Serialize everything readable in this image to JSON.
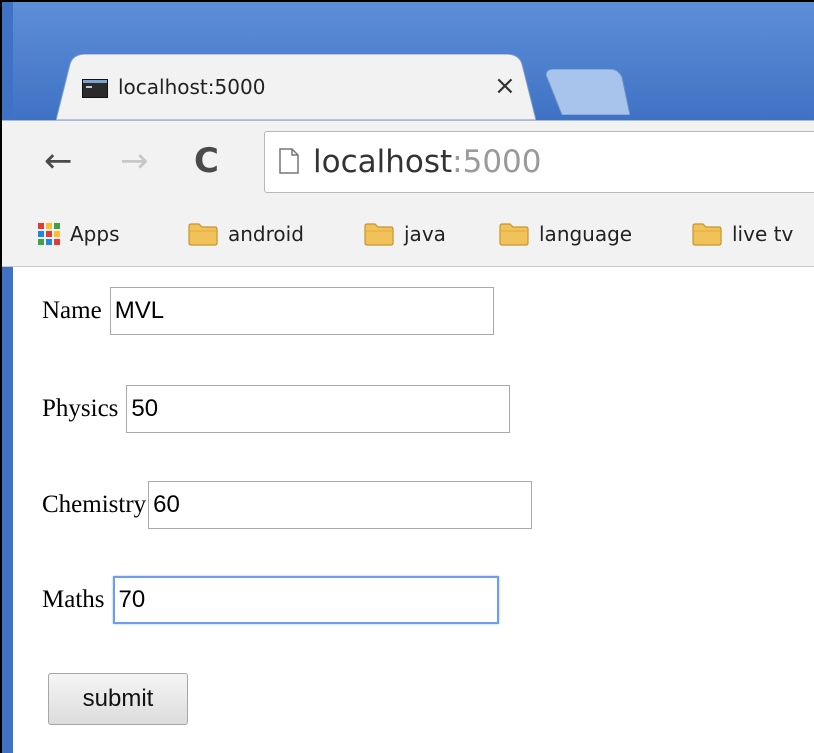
{
  "tab": {
    "title": "localhost:5000",
    "close_label": "×"
  },
  "toolbar": {
    "back_icon": "back-arrow-icon",
    "forward_icon": "forward-arrow-icon",
    "reload_icon": "reload-icon",
    "url_host": "localhost",
    "url_port": ":5000"
  },
  "bookmarks": {
    "items": [
      {
        "label": "Apps",
        "icon": "apps-grid-icon"
      },
      {
        "label": "android",
        "icon": "folder-icon"
      },
      {
        "label": "java",
        "icon": "folder-icon"
      },
      {
        "label": "language",
        "icon": "folder-icon"
      },
      {
        "label": "live tv",
        "icon": "folder-icon"
      }
    ]
  },
  "form": {
    "name": {
      "label": "Name",
      "value": "MVL"
    },
    "physics": {
      "label": "Physics",
      "value": "50"
    },
    "chemistry": {
      "label": "Chemistry",
      "value": "60"
    },
    "maths": {
      "label": "Maths",
      "value": "70"
    },
    "submit_label": "submit"
  },
  "colors": {
    "tabstrip": "#3f72c4",
    "focus_ring": "#6d9eeb",
    "folder": "#f2c25a"
  }
}
